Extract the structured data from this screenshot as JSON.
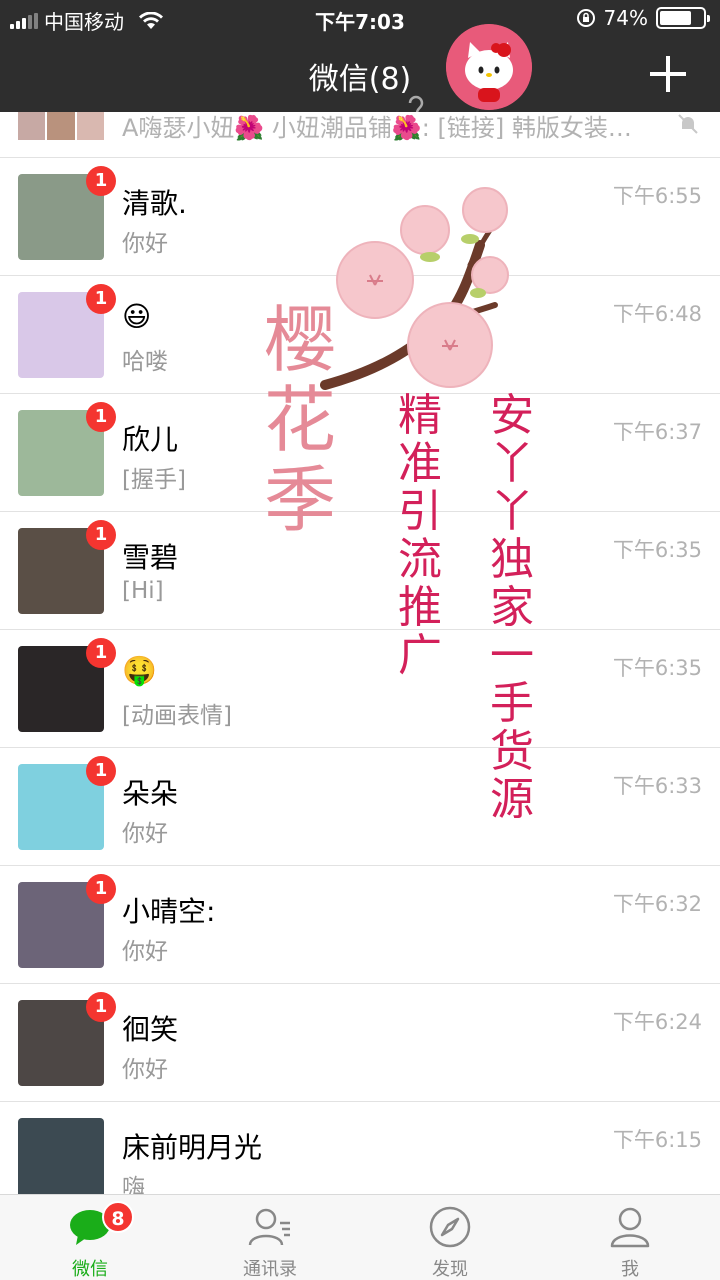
{
  "status_bar": {
    "carrier": "中国移动",
    "time": "下午7:03",
    "battery": "74%",
    "battery_level": 0.74
  },
  "nav": {
    "title": "微信(8)",
    "ear_icon": "ear-icon",
    "add_icon": "plus-icon"
  },
  "partial_row": {
    "text": "A嗨瑟小妞🌺 小妞潮品铺🌺: [链接] 韩版女装…"
  },
  "chats": [
    {
      "name": "清歌.",
      "preview": "你好",
      "time": "下午6:55",
      "badge": "1",
      "color": "#8a9a88"
    },
    {
      "name": "😃",
      "preview": "哈喽",
      "time": "下午6:48",
      "badge": "1",
      "color": "#d9c8e8"
    },
    {
      "name": "欣儿",
      "preview": "[握手]",
      "time": "下午6:37",
      "badge": "1",
      "color": "#9db89a"
    },
    {
      "name": "雪碧",
      "preview": "[Hi]",
      "time": "下午6:35",
      "badge": "1",
      "color": "#5a4f46"
    },
    {
      "name": "🤑",
      "preview": "[动画表情]",
      "time": "下午6:35",
      "badge": "1",
      "color": "#2a2627"
    },
    {
      "name": "朵朵",
      "preview": "你好",
      "time": "下午6:33",
      "badge": "1",
      "color": "#7fd0df"
    },
    {
      "name": "小晴空:",
      "preview": "你好",
      "time": "下午6:32",
      "badge": "1",
      "color": "#6c6478"
    },
    {
      "name": "徊笑",
      "preview": "你好",
      "time": "下午6:24",
      "badge": "1",
      "color": "#4d4745"
    },
    {
      "name": "床前明月光",
      "preview": "嗨",
      "time": "下午6:15",
      "badge": "",
      "color": "#3c4a52"
    }
  ],
  "overlay": {
    "sakura": "樱花季",
    "line1": "精准引流推广",
    "line2": "安丫丫独家一手货源"
  },
  "tabs": [
    {
      "label": "微信",
      "icon": "chat-bubble-icon",
      "badge": "8"
    },
    {
      "label": "通讯录",
      "icon": "contacts-icon",
      "badge": ""
    },
    {
      "label": "发现",
      "icon": "compass-icon",
      "badge": ""
    },
    {
      "label": "我",
      "icon": "person-icon",
      "badge": ""
    }
  ],
  "colors": {
    "header_bg": "#2e2e2e",
    "badge_red": "#f43530",
    "active_green": "#1aad19",
    "overlay_text": "#d3205a"
  }
}
